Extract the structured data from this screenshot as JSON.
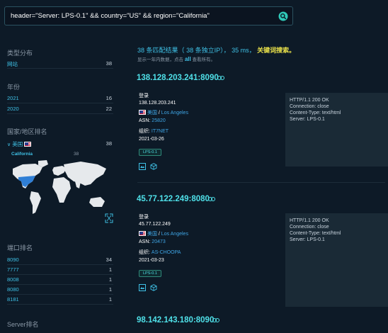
{
  "search": {
    "query": "header=\"Server: LPS-0.1\" && country=\"US\" && region=\"California\""
  },
  "sidebar": {
    "type_title": "类型分布",
    "types": [
      {
        "label": "网站",
        "count": "38"
      }
    ],
    "year_title": "年份",
    "years": [
      {
        "label": "2021",
        "count": "16"
      },
      {
        "label": "2020",
        "count": "22"
      }
    ],
    "country_title": "国家/地区排名",
    "countries": [
      {
        "label": "美国",
        "count": "38"
      }
    ],
    "regions": [
      {
        "label": "California",
        "count": "38"
      }
    ],
    "port_title": "端口排名",
    "ports": [
      {
        "label": "8090",
        "count": "34"
      },
      {
        "label": "7777",
        "count": "1"
      },
      {
        "label": "8008",
        "count": "1"
      },
      {
        "label": "8080",
        "count": "1"
      },
      {
        "label": "8181",
        "count": "1"
      }
    ],
    "server_title": "Server排名"
  },
  "summary": {
    "match_count": "38",
    "match_text": "条匹配结果（",
    "ip_count": "38",
    "ip_text": "条独立IP），",
    "ms": "35",
    "ms_text": "ms，",
    "keyword": "关键词搜索。",
    "sub_text": "显示一年内数据，点击",
    "all_label": "all",
    "sub_tail": "查看所有。"
  },
  "results": [
    {
      "host": "138.128.203.241:8090",
      "title_label": "登录",
      "ip": "138.128.203.241",
      "country": "美国",
      "city": "Los Angeles",
      "asn_label": "ASN:",
      "asn": "25820",
      "org_label": "组织:",
      "org": "IT7NET",
      "date": "2021-03-26",
      "badge": "LPS-0.1",
      "banner": [
        "HTTP/1.1 200 OK",
        "Connection: close",
        "Content-Type: text/html",
        "Server: LPS-0.1"
      ]
    },
    {
      "host": "45.77.122.249:8080",
      "title_label": "登录",
      "ip": "45.77.122.249",
      "country": "美国",
      "city": "Los Angeles",
      "asn_label": "ASN:",
      "asn": "20473",
      "org_label": "组织:",
      "org": "AS-CHOOPA",
      "date": "2021-03-23",
      "badge": "LPS-0.1",
      "banner": [
        "HTTP/1.1 200 OK",
        "Connection: close",
        "Content-Type: text/html",
        "Server: LPS-0.1"
      ]
    },
    {
      "host": "98.142.143.180:8090"
    }
  ],
  "colors": {
    "background": "#0d1a27",
    "accent": "#4fe0e8",
    "link": "#3fa6e6",
    "keyword": "#e8e04a"
  }
}
